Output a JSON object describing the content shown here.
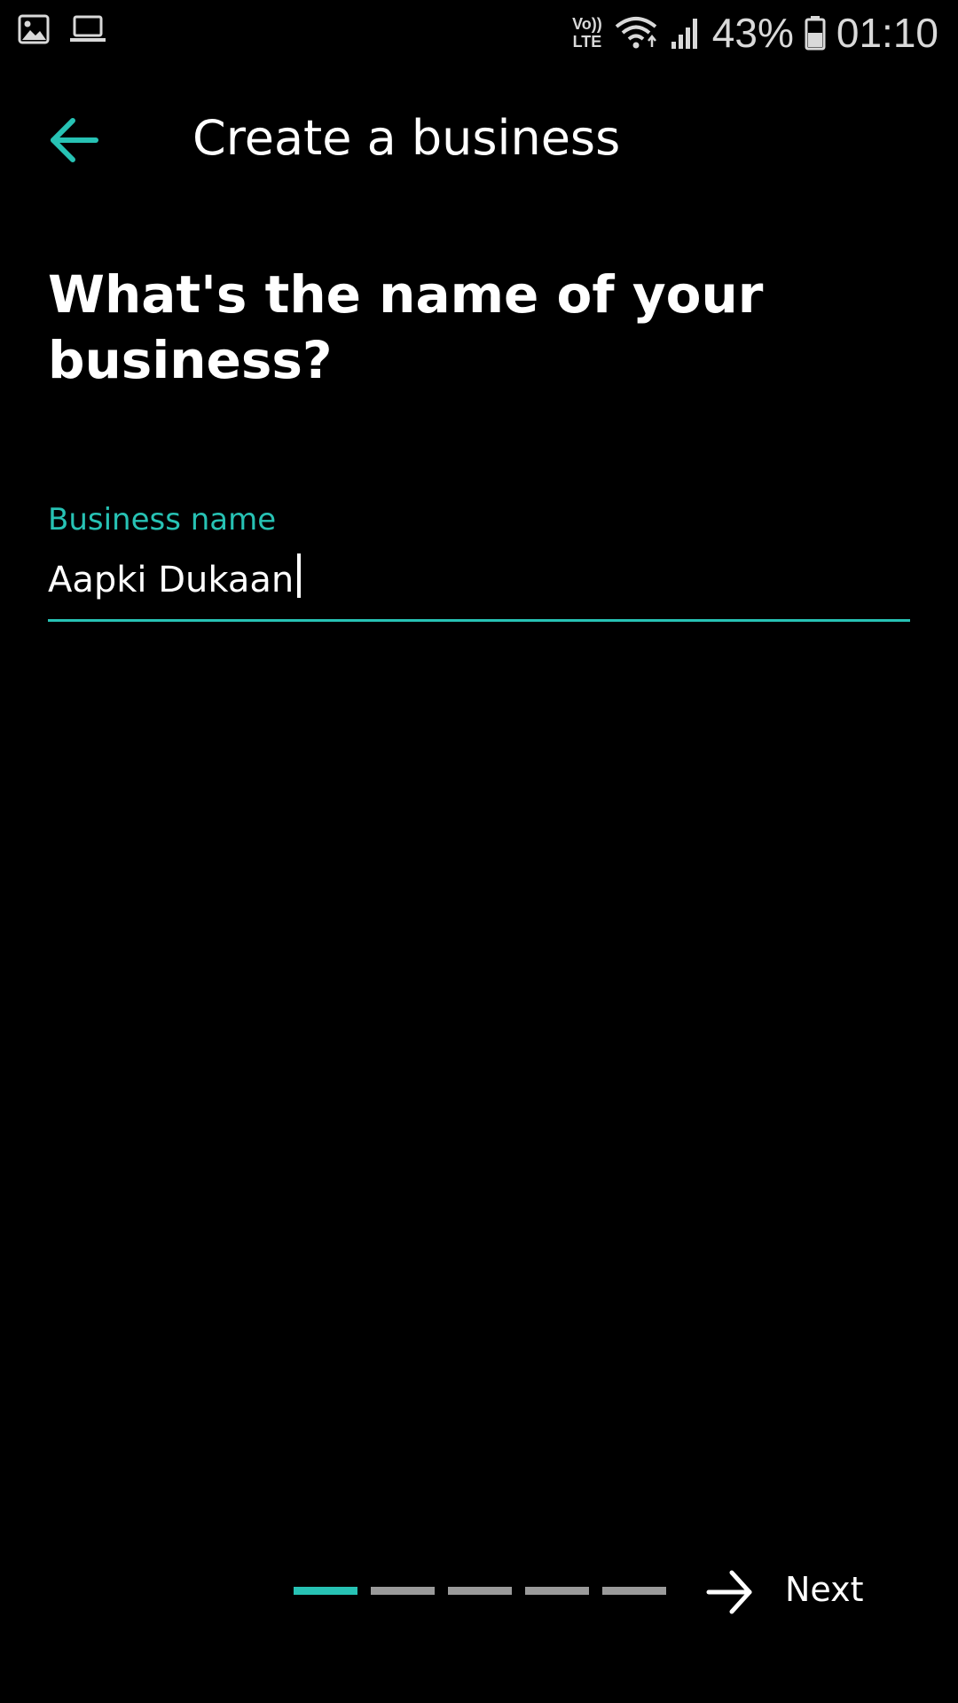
{
  "status_bar": {
    "left_icons": [
      "gallery-icon",
      "laptop-icon"
    ],
    "volte_top": "Vo))",
    "volte_bottom": "LTE",
    "battery": "43%",
    "time": "01:10"
  },
  "app_bar": {
    "title": "Create a business",
    "back_icon": "arrow-left-icon"
  },
  "question": "What's the name of your business?",
  "field": {
    "label": "Business name",
    "value": "Aapki Dukaan"
  },
  "progress": {
    "total_steps": 5,
    "current_step": 1
  },
  "next": {
    "label": "Next",
    "icon": "arrow-right-icon"
  },
  "colors": {
    "accent": "#27c2b4",
    "background": "#000000",
    "inactive_step": "#9a9a9a"
  }
}
